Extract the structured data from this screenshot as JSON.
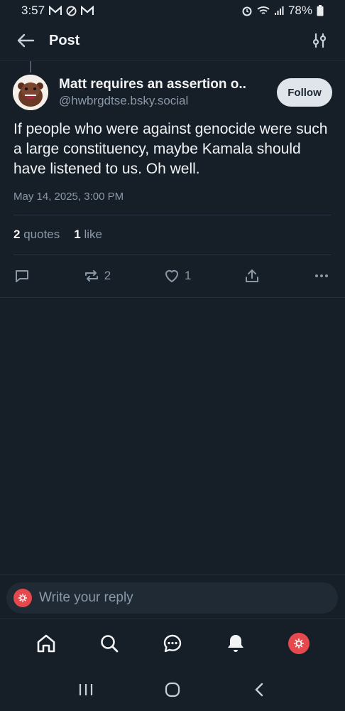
{
  "status_bar": {
    "time": "3:57",
    "battery": "78%"
  },
  "header": {
    "title": "Post"
  },
  "post": {
    "display_name": "Matt requires an assertion o..",
    "handle": "@hwbrgdtse.bsky.social",
    "follow_label": "Follow",
    "text": "If people who were against genocide were such a large constituency, maybe Kamala should have listened to us.  Oh well.",
    "date": "May 14, 2025, 3:00 PM",
    "quotes_count": "2",
    "quotes_label": "quotes",
    "likes_count": "1",
    "likes_label": "like",
    "repost_count": "2",
    "like_count": "1"
  },
  "composer": {
    "placeholder": "Write your reply"
  },
  "colors": {
    "background": "#161e27",
    "accent_avatar": "#e5484d",
    "muted": "#8a98a8",
    "follow_bg": "#dfe5eb"
  },
  "icons": [
    "back-arrow-icon",
    "filter-icon",
    "reply-icon",
    "repost-icon",
    "heart-icon",
    "share-icon",
    "more-icon",
    "home-icon",
    "search-icon",
    "chat-icon",
    "bell-icon"
  ]
}
